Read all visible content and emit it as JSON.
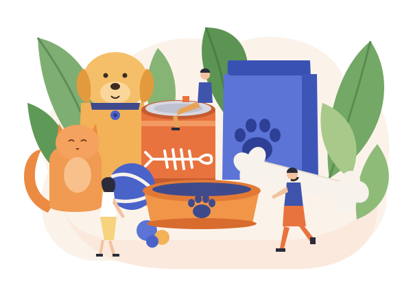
{
  "illustration": {
    "subject": "pet-supplies-flat-illustration",
    "icons": [
      "dog-icon",
      "cat-icon",
      "food-bag-icon",
      "pet-food-can-icon",
      "food-bowl-icon",
      "ball-icon",
      "bone-icon",
      "paw-print-icon",
      "fish-bone-icon"
    ],
    "colors": {
      "background_blob": "#fbf3ea",
      "leaf_green": "#6fa36a",
      "leaf_light": "#a8c98a",
      "dog_orange": "#f3b257",
      "dog_collar": "#3e4a8c",
      "cat_orange": "#ec8a42",
      "bag_blue": "#4a63c9",
      "bag_dark": "#2e3f96",
      "can_orange": "#e8733e",
      "bowl_orange": "#f19549",
      "bone": "#f7f2ec",
      "people_blue": "#3f54ad"
    }
  }
}
